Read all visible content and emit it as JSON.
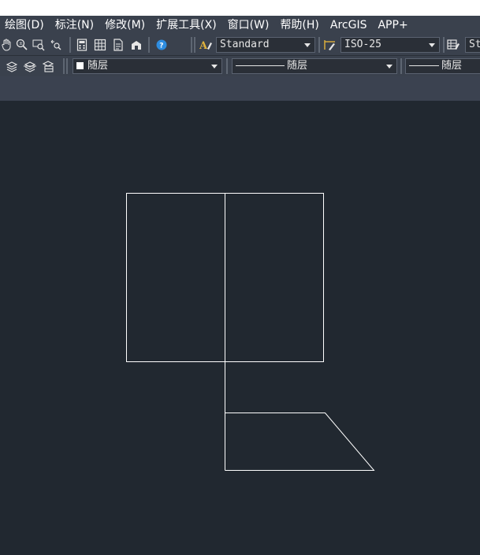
{
  "menubar": {
    "items": [
      "绘图(D)",
      "标注(N)",
      "修改(M)",
      "扩展工具(X)",
      "窗口(W)",
      "帮助(H)",
      "ArcGIS",
      "APP+"
    ]
  },
  "toolbar1": {
    "text_style": "Standard",
    "dim_style": "ISO-25",
    "table_style_partial": "St"
  },
  "toolbar2": {
    "color": "随层",
    "linetype": "随层",
    "lineweight": "随层"
  },
  "icons": {
    "toolbar1": [
      "pan-hand-icon",
      "zoom-realtime-icon",
      "zoom-window-icon",
      "zoom-previous-icon",
      "calculator-icon",
      "table-grid-icon",
      "properties-icon",
      "design-center-icon",
      "help-icon",
      "text-style-icon",
      "dim-style-icon",
      "table-style-icon"
    ],
    "toolbar2": [
      "layer-match-icon",
      "layer-previous-icon",
      "layer-states-icon"
    ]
  },
  "colors": {
    "chrome": "#3a414d",
    "canvas": "#212830",
    "geometry": "#ffffff",
    "help_accent": "#2e8de0",
    "text_style_accent": "#e0b23c"
  }
}
